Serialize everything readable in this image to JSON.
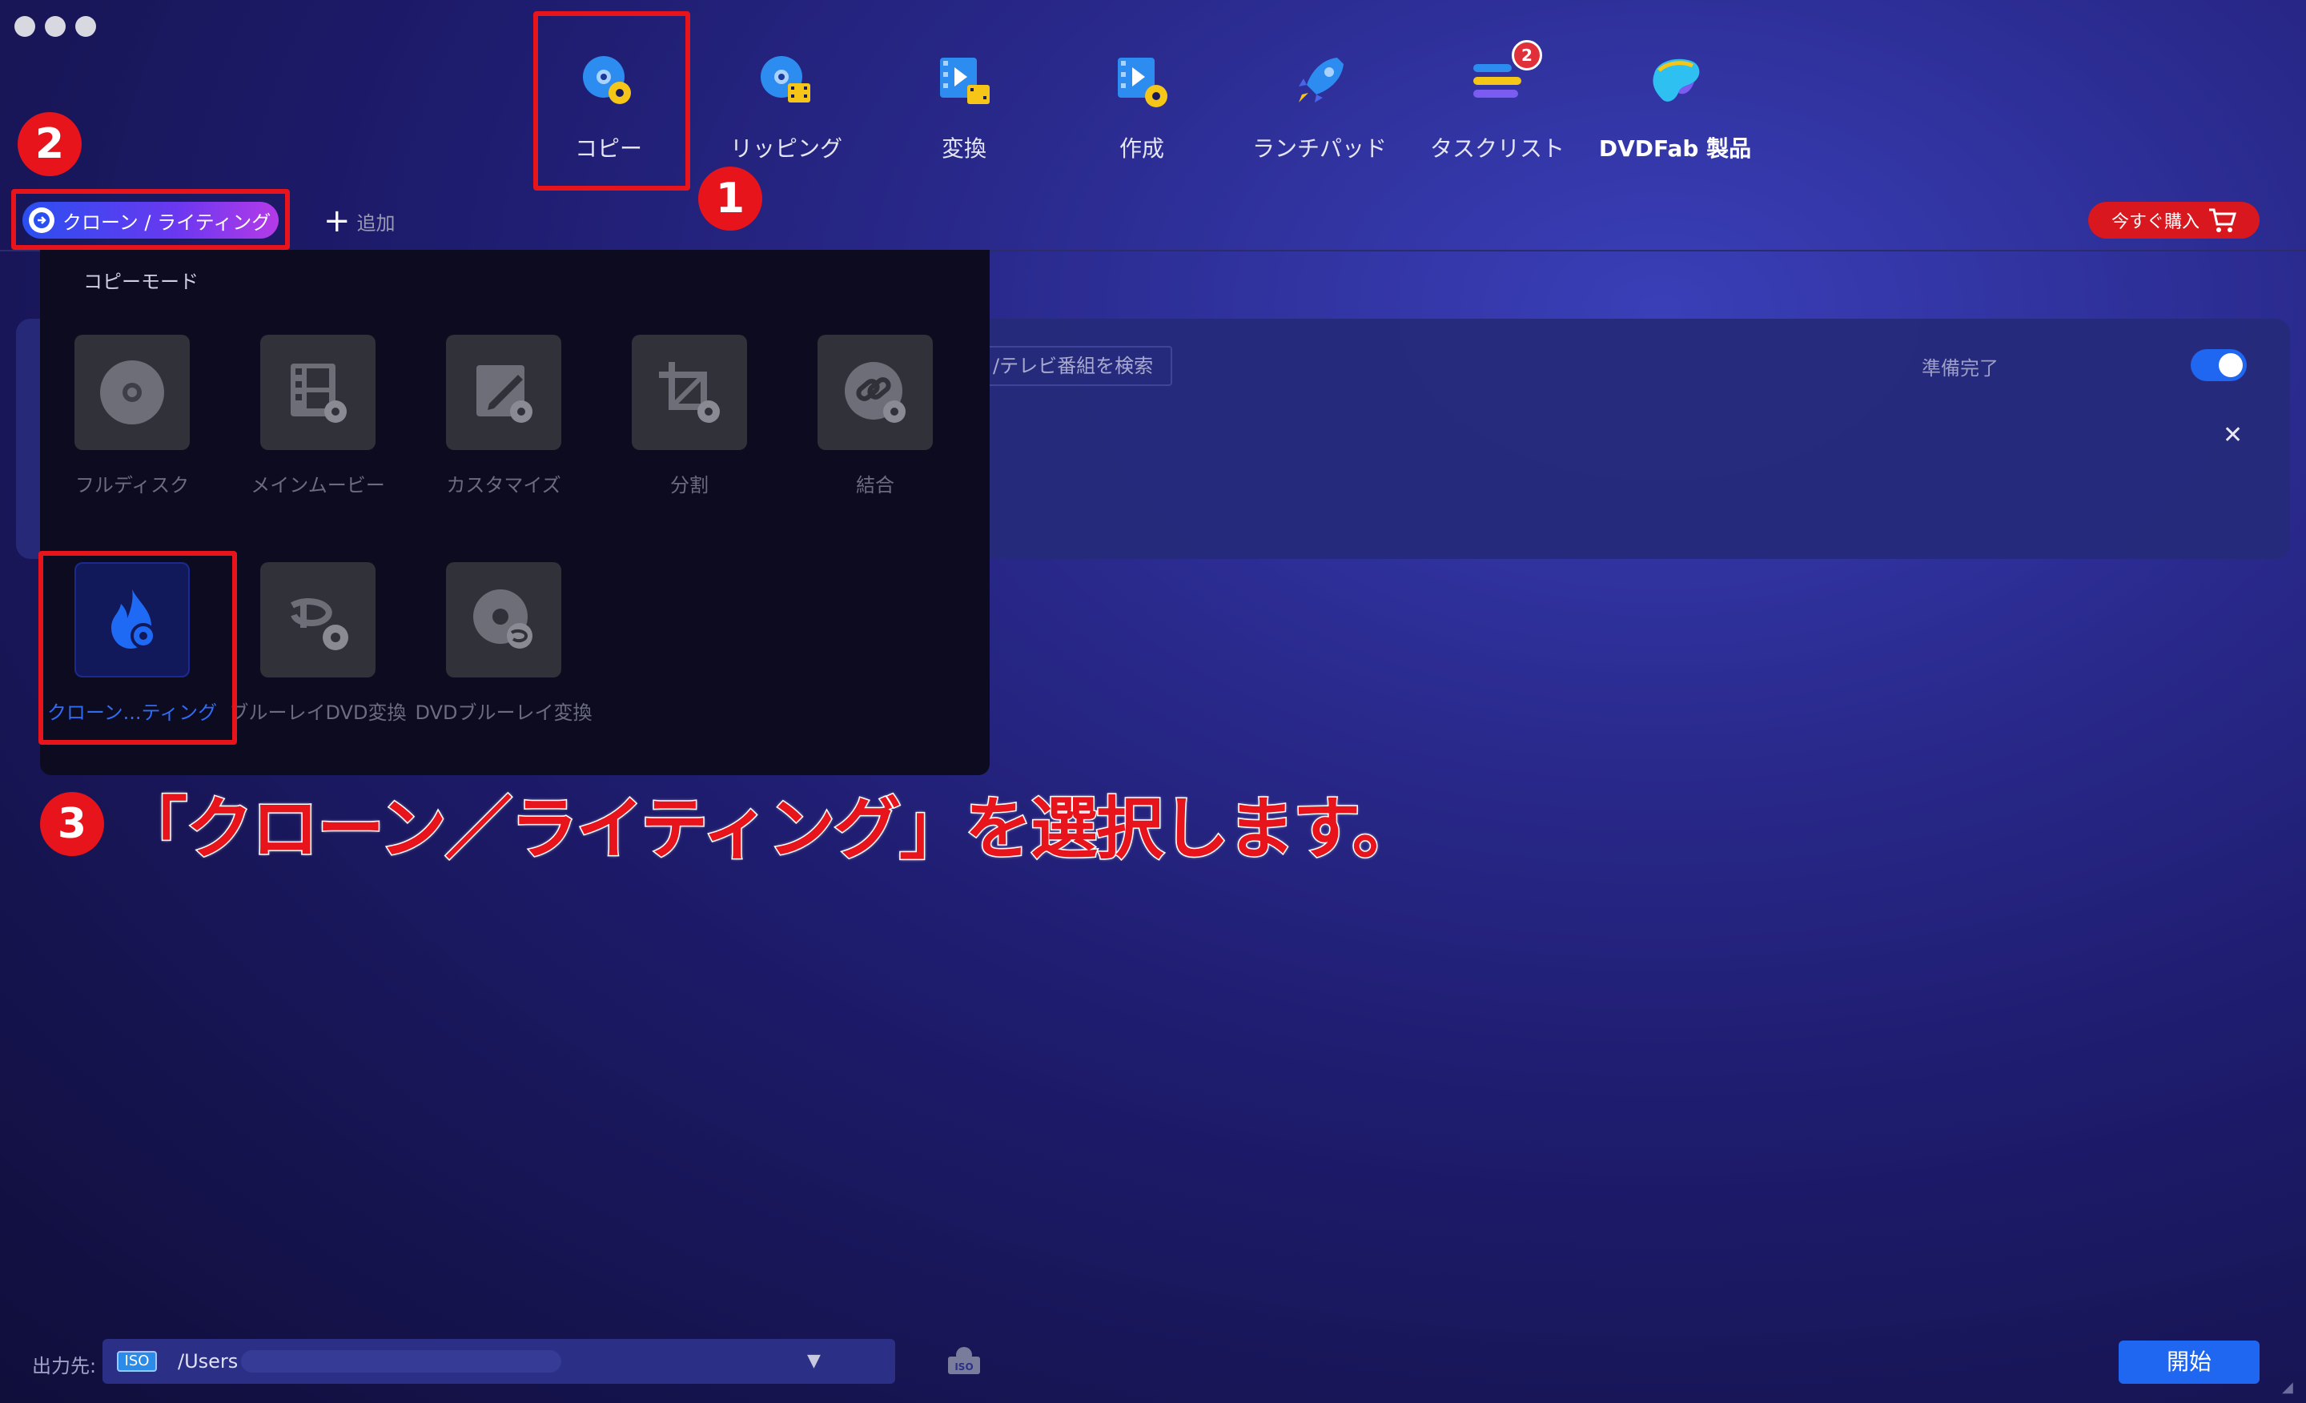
{
  "nav": {
    "items": [
      {
        "label": "コピー",
        "icon": "disc-copy-icon"
      },
      {
        "label": "リッピング",
        "icon": "disc-rip-icon"
      },
      {
        "label": "変換",
        "icon": "video-convert-icon"
      },
      {
        "label": "作成",
        "icon": "video-create-icon"
      },
      {
        "label": "ランチパッド",
        "icon": "rocket-icon"
      },
      {
        "label": "タスクリスト",
        "icon": "task-list-icon",
        "badge": "2"
      },
      {
        "label": "DVDFab 製品",
        "icon": "dvdfab-logo-icon"
      }
    ]
  },
  "toolbar": {
    "mode_label": "クローン / ライティング",
    "add_label": "追加",
    "buy_label": "今すぐ購入"
  },
  "content": {
    "search_text": "/テレビ番組を検索",
    "status": "準備完了",
    "toggle_on": true,
    "close_glyph": "✕"
  },
  "copy_mode": {
    "title": "コピーモード",
    "modes": [
      {
        "label": "フルディスク",
        "icon": "full-disc-icon"
      },
      {
        "label": "メインムービー",
        "icon": "main-movie-icon"
      },
      {
        "label": "カスタマイズ",
        "icon": "customize-icon"
      },
      {
        "label": "分割",
        "icon": "split-icon"
      },
      {
        "label": "結合",
        "icon": "merge-icon"
      },
      {
        "label": "クローン...ティング",
        "icon": "clone-burn-icon",
        "selected": true
      },
      {
        "label": "ブルーレイDVD変換",
        "icon": "bluray-to-dvd-icon"
      },
      {
        "label": "DVDブルーレイ変換",
        "icon": "dvd-to-bluray-icon"
      }
    ]
  },
  "annotations": {
    "marker1": "1",
    "marker2": "2",
    "marker3": "3",
    "instruction": "「クローン／ライティング」を選択します。"
  },
  "bottom": {
    "output_label": "出力先:",
    "format_chip": "ISO",
    "path": "/Users",
    "start_label": "開始"
  },
  "colors": {
    "accent_blue": "#1f66f0",
    "annotation_red": "#e8141c",
    "buy_red": "#d8181e"
  }
}
